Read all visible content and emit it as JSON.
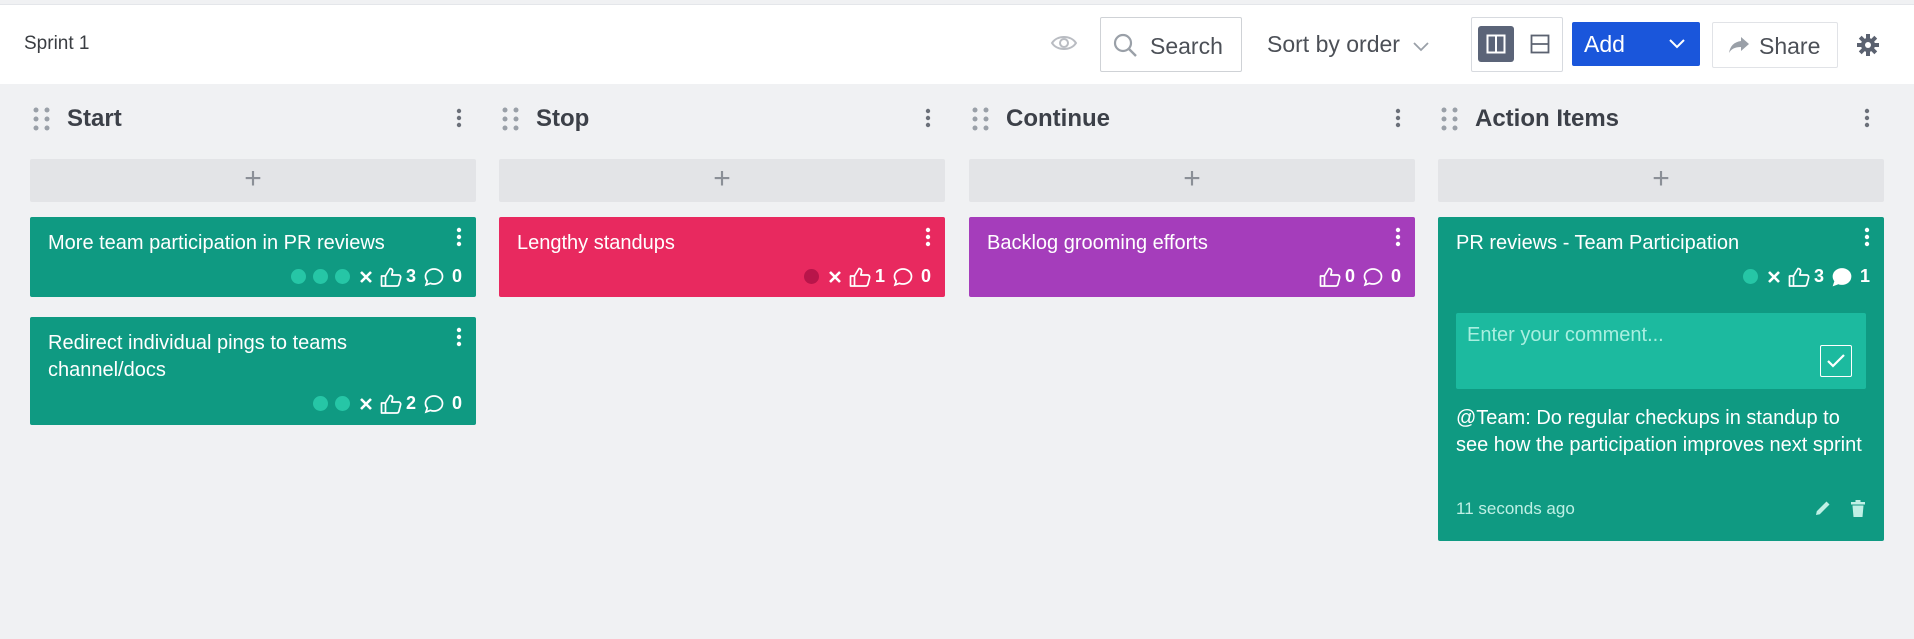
{
  "board": {
    "title": "Sprint 1"
  },
  "toolbar": {
    "search_label": "Search",
    "sort_label": "Sort by order",
    "add_label": "Add",
    "share_label": "Share"
  },
  "colors": {
    "green": "#0f9a82",
    "pink": "#e8295f",
    "purple": "#a53dbb",
    "primary": "#1a56db"
  },
  "columns": [
    {
      "title": "Start",
      "cards": [
        {
          "text": "More team participation in PR reviews",
          "dots": 3,
          "likes": "3",
          "comments": "0"
        },
        {
          "text": "Redirect individual pings to teams channel/docs",
          "dots": 2,
          "likes": "2",
          "comments": "0"
        }
      ]
    },
    {
      "title": "Stop",
      "cards": [
        {
          "text": "Lengthy standups",
          "dots": 1,
          "likes": "1",
          "comments": "0"
        }
      ]
    },
    {
      "title": "Continue",
      "cards": [
        {
          "text": "Backlog grooming efforts",
          "dots": 0,
          "likes": "0",
          "comments": "0"
        }
      ]
    },
    {
      "title": "Action Items",
      "cards": [
        {
          "text": "PR reviews - Team Participation",
          "dots": 1,
          "likes": "3",
          "comments": "1",
          "comment_placeholder": "Enter your comment...",
          "comment": {
            "text": "@Team: Do regular checkups in standup to see how the participation improves next sprint",
            "time": "11 seconds ago"
          }
        }
      ]
    }
  ]
}
